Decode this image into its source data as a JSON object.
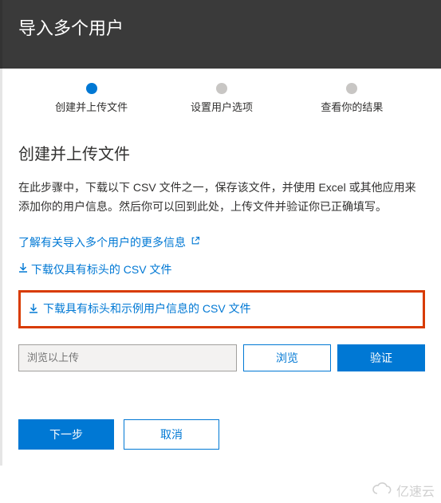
{
  "header": {
    "title": "导入多个用户"
  },
  "stepper": {
    "steps": [
      {
        "label": "创建并上传文件",
        "active": true
      },
      {
        "label": "设置用户选项",
        "active": false
      },
      {
        "label": "查看你的结果",
        "active": false
      }
    ]
  },
  "section": {
    "title": "创建并上传文件",
    "description": "在此步骤中，下载以下 CSV 文件之一，保存该文件，并使用 Excel 或其他应用来添加你的用户信息。然后你可以回到此处，上传文件并验证你已正确填写。"
  },
  "links": {
    "learn_more": "了解有关导入多个用户的更多信息",
    "download_headers": "下载仅具有标头的 CSV 文件",
    "download_sample": "下载具有标头和示例用户信息的 CSV 文件"
  },
  "file": {
    "placeholder": "浏览以上传",
    "browse_label": "浏览",
    "verify_label": "验证"
  },
  "footer": {
    "next_label": "下一步",
    "cancel_label": "取消"
  },
  "watermark": {
    "text": "亿速云"
  }
}
